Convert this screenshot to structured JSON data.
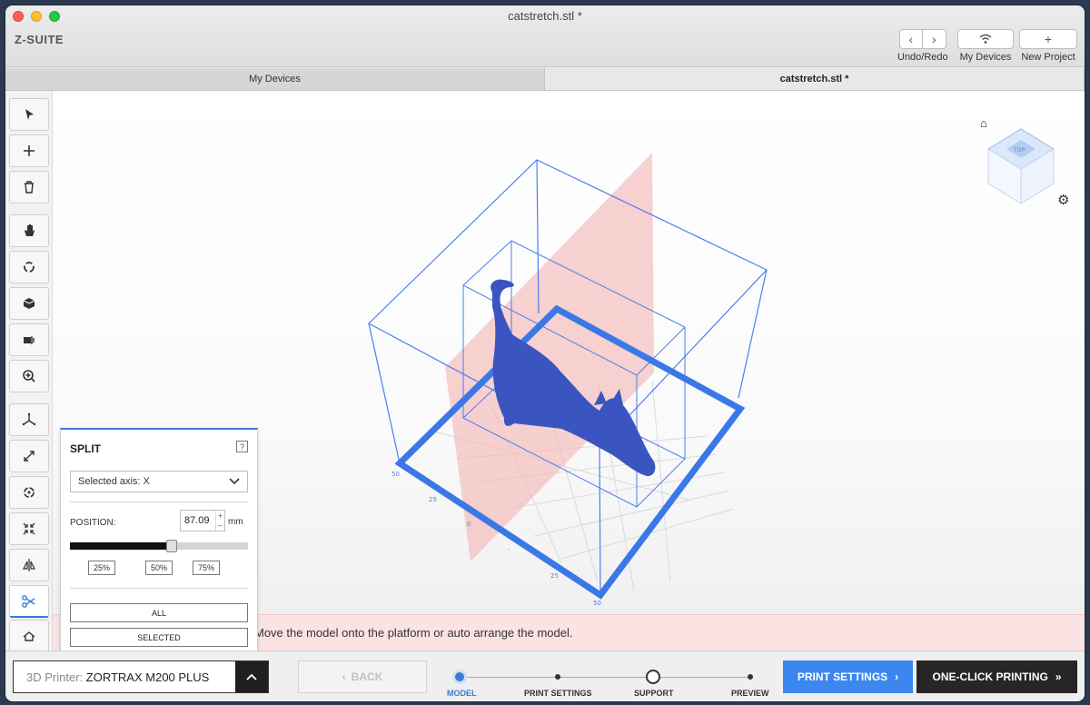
{
  "window": {
    "title": "catstretch.stl *"
  },
  "app": {
    "logo": "Z-SUITE"
  },
  "toolbar": {
    "undo_redo_label": "Undo/Redo",
    "undo_icon": "‹",
    "redo_icon": "›",
    "devices_label": "My Devices",
    "new_project_label": "New Project",
    "new_project_icon": "+"
  },
  "tabs": [
    {
      "label": "My Devices"
    },
    {
      "label": "catstretch.stl *"
    }
  ],
  "left_tools": [
    {
      "icon": "select-arrow-icon"
    },
    {
      "icon": "add-icon"
    },
    {
      "icon": "trash-icon"
    },
    {
      "icon": "pan-hand-icon"
    },
    {
      "icon": "rotate-view-icon"
    },
    {
      "icon": "cube-view-icon"
    },
    {
      "icon": "fit-view-icon"
    },
    {
      "icon": "zoom-icon"
    },
    {
      "icon": "move-icon"
    },
    {
      "icon": "scale-icon"
    },
    {
      "icon": "rotate-model-icon"
    },
    {
      "icon": "auto-arrange-icon"
    },
    {
      "icon": "mirror-icon"
    },
    {
      "icon": "scissors-icon",
      "active": true
    },
    {
      "icon": "place-on-platform-icon"
    }
  ],
  "viewport": {
    "nav_cube_label": "TOP",
    "message": "Move the model onto the platform or auto arrange the model."
  },
  "split_panel": {
    "title": "SPLIT",
    "help": "?",
    "axis_select": "Selected axis: X",
    "position_label": "POSITION:",
    "position_value": "87.09",
    "position_unit": "mm",
    "slider_fraction": 0.57,
    "presets": [
      "25%",
      "50%",
      "75%"
    ],
    "all_button": "ALL",
    "selected_button": "SELECTED"
  },
  "bottom": {
    "printer_prefix": "3D Printer:",
    "printer_name": "ZORTRAX M200 PLUS",
    "back_button": "BACK",
    "steps": [
      "MODEL",
      "PRINT SETTINGS",
      "SUPPORT",
      "PREVIEW"
    ],
    "current_step": "MODEL",
    "print_settings_button": "PRINT SETTINGS",
    "one_click_button": "ONE-CLICK PRINTING"
  },
  "colors": {
    "accent": "#3a87f0",
    "model": "#3b5bc4",
    "cut_plane": "#f4b8b8",
    "message_bg": "#fbe3e3"
  }
}
